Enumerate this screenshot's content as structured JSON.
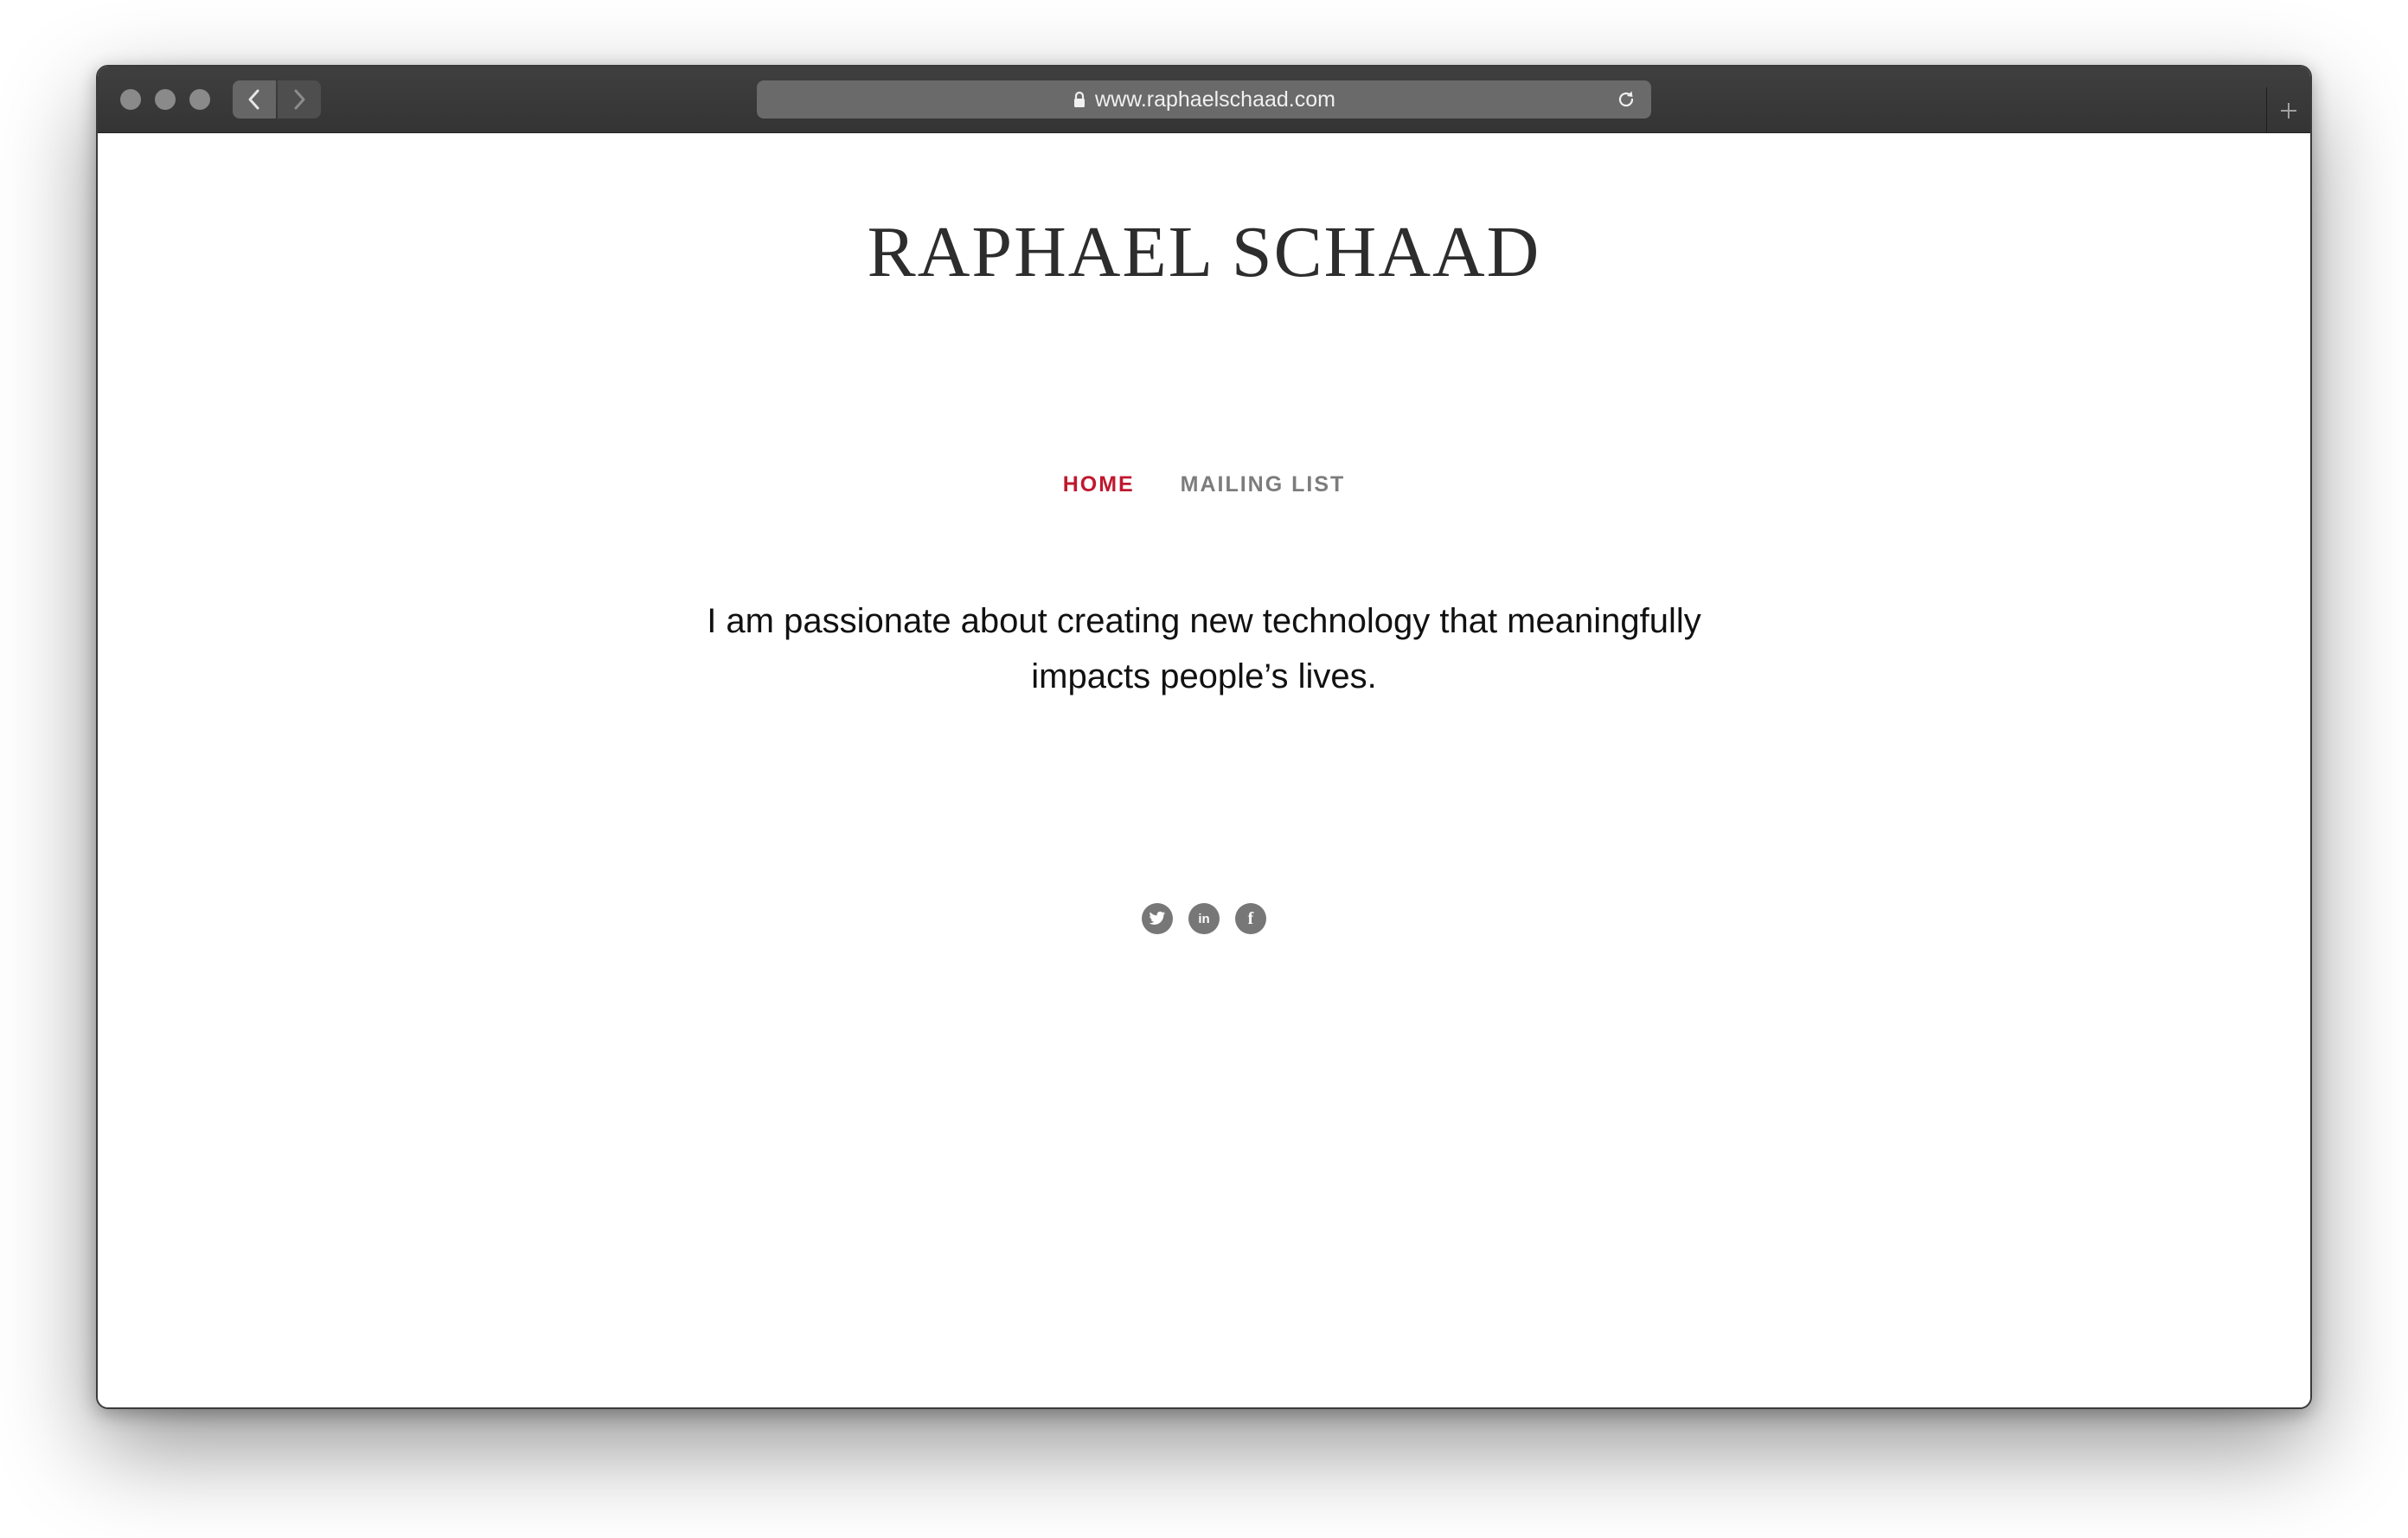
{
  "browser": {
    "url": "www.raphaelschaad.com",
    "icons": {
      "back": "chevron-left-icon",
      "forward": "chevron-right-icon",
      "lock": "lock-icon",
      "reload": "reload-icon",
      "new_tab": "plus-icon"
    }
  },
  "site": {
    "title": "RAPHAEL SCHAAD",
    "nav": {
      "items": [
        {
          "label": "HOME",
          "active": true
        },
        {
          "label": "MAILING LIST",
          "active": false
        }
      ]
    },
    "tagline_line1": "I am passionate about creating new technology that meaningfully",
    "tagline_line2": "impacts people’s lives.",
    "social": {
      "items": [
        {
          "icon": "twitter-icon"
        },
        {
          "icon": "linkedin-icon",
          "glyph": "in"
        },
        {
          "icon": "facebook-icon",
          "glyph": "f"
        }
      ]
    }
  },
  "colors": {
    "accent": "#c0182f",
    "nav_inactive": "#7c7c7c",
    "title": "#2d2d2d",
    "social_bg": "#777777"
  }
}
